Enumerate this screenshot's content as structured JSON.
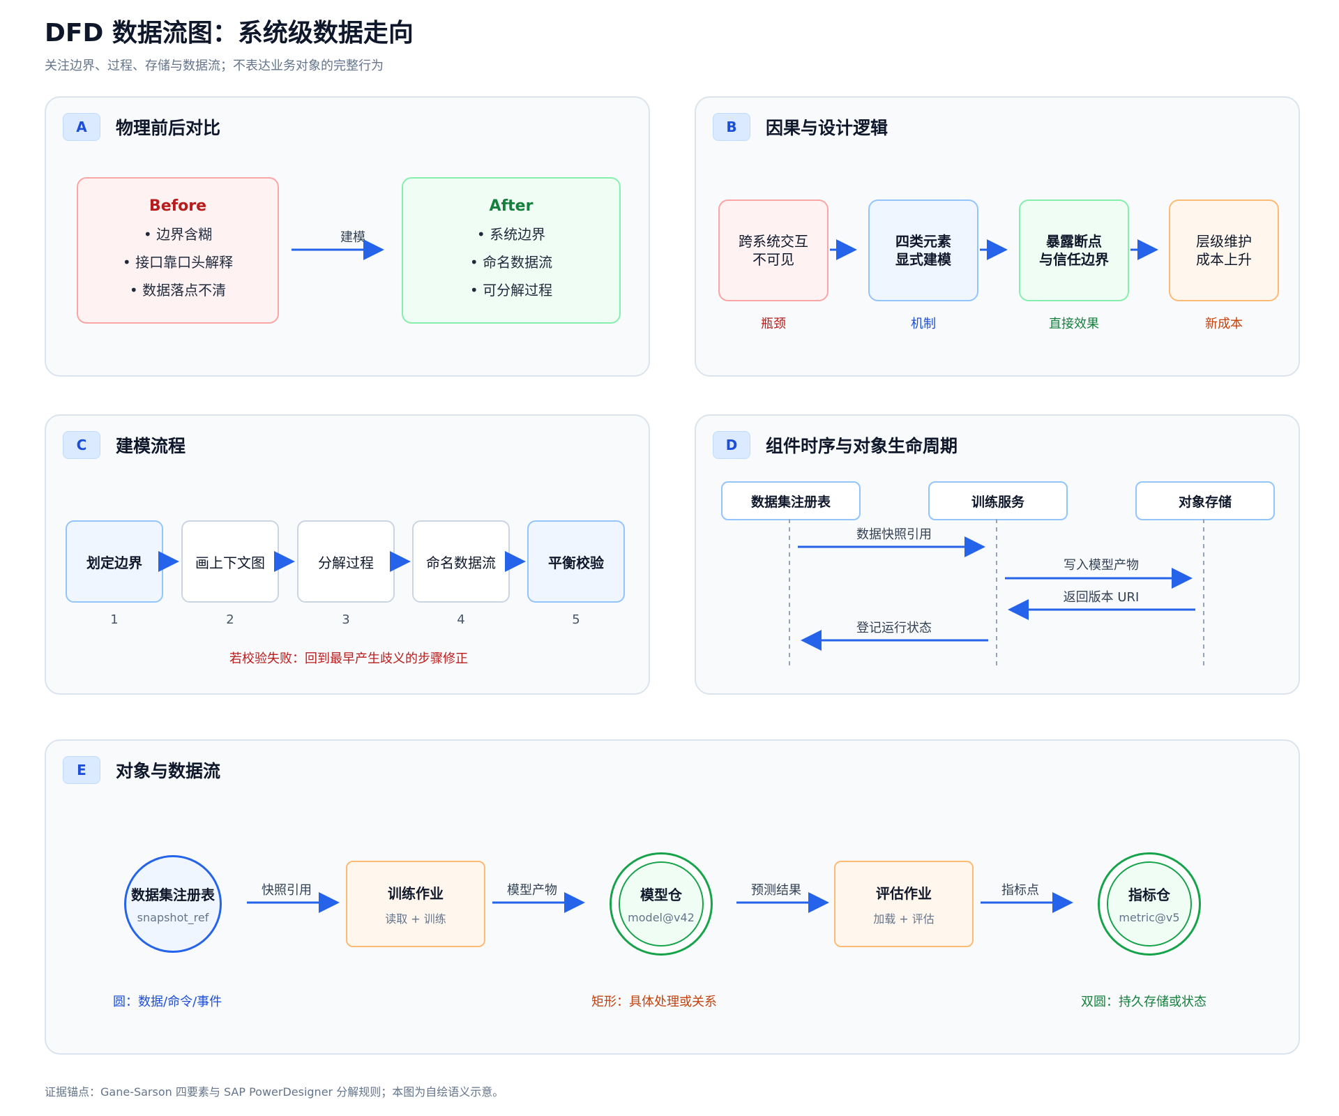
{
  "header": {
    "title": "DFD 数据流图：系统级数据走向",
    "subtitle": "关注边界、过程、存储与数据流；不表达业务对象的完整行为"
  },
  "panels": {
    "a": {
      "badge": "A",
      "title": "物理前后对比",
      "before": {
        "title": "Before",
        "items": [
          "• 边界含糊",
          "• 接口靠口头解释",
          "• 数据落点不清"
        ]
      },
      "after": {
        "title": "After",
        "items": [
          "• 系统边界",
          "• 命名数据流",
          "• 可分解过程"
        ]
      },
      "arrow_label": "建模"
    },
    "b": {
      "badge": "B",
      "title": "因果与设计逻辑",
      "steps": [
        {
          "text": "跨系统交互\n不可见",
          "caption": "瓶颈"
        },
        {
          "text": "四类元素\n显式建模",
          "caption": "机制"
        },
        {
          "text": "暴露断点\n与信任边界",
          "caption": "直接效果"
        },
        {
          "text": "层级维护\n成本上升",
          "caption": "新成本"
        }
      ]
    },
    "c": {
      "badge": "C",
      "title": "建模流程",
      "steps": [
        {
          "label": "划定边界",
          "num": "1"
        },
        {
          "label": "画上下文图",
          "num": "2"
        },
        {
          "label": "分解过程",
          "num": "3"
        },
        {
          "label": "命名数据流",
          "num": "4"
        },
        {
          "label": "平衡校验",
          "num": "5"
        }
      ],
      "note": "若校验失败：回到最早产生歧义的步骤修正"
    },
    "d": {
      "badge": "D",
      "title": "组件时序与对象生命周期",
      "lanes": [
        "数据集注册表",
        "训练服务",
        "对象存储"
      ],
      "messages": [
        "数据快照引用",
        "写入模型产物",
        "返回版本 URI",
        "登记运行状态"
      ]
    },
    "e": {
      "badge": "E",
      "title": "对象与数据流",
      "nodes": [
        {
          "title": "数据集注册表",
          "sub": "snapshot_ref"
        },
        {
          "title": "训练作业",
          "sub": "读取 + 训练"
        },
        {
          "title": "模型仓",
          "sub": "model@v42"
        },
        {
          "title": "评估作业",
          "sub": "加载 + 评估"
        },
        {
          "title": "指标仓",
          "sub": "metric@v5"
        }
      ],
      "edges": [
        "快照引用",
        "模型产物",
        "预测结果",
        "指标点"
      ],
      "legend": [
        "圆：数据/命令/事件",
        "矩形：具体处理或关系",
        "双圆：持久存储或状态"
      ]
    }
  },
  "footer": "证据锚点：Gane-Sarson 四要素与 SAP PowerDesigner 分解规则；本图为自绘语义示意。",
  "colors": {
    "arrow": "#2563eb",
    "red": "#b91c1c",
    "blue": "#1d4ed8",
    "green": "#15803d",
    "orange": "#c2410c"
  }
}
